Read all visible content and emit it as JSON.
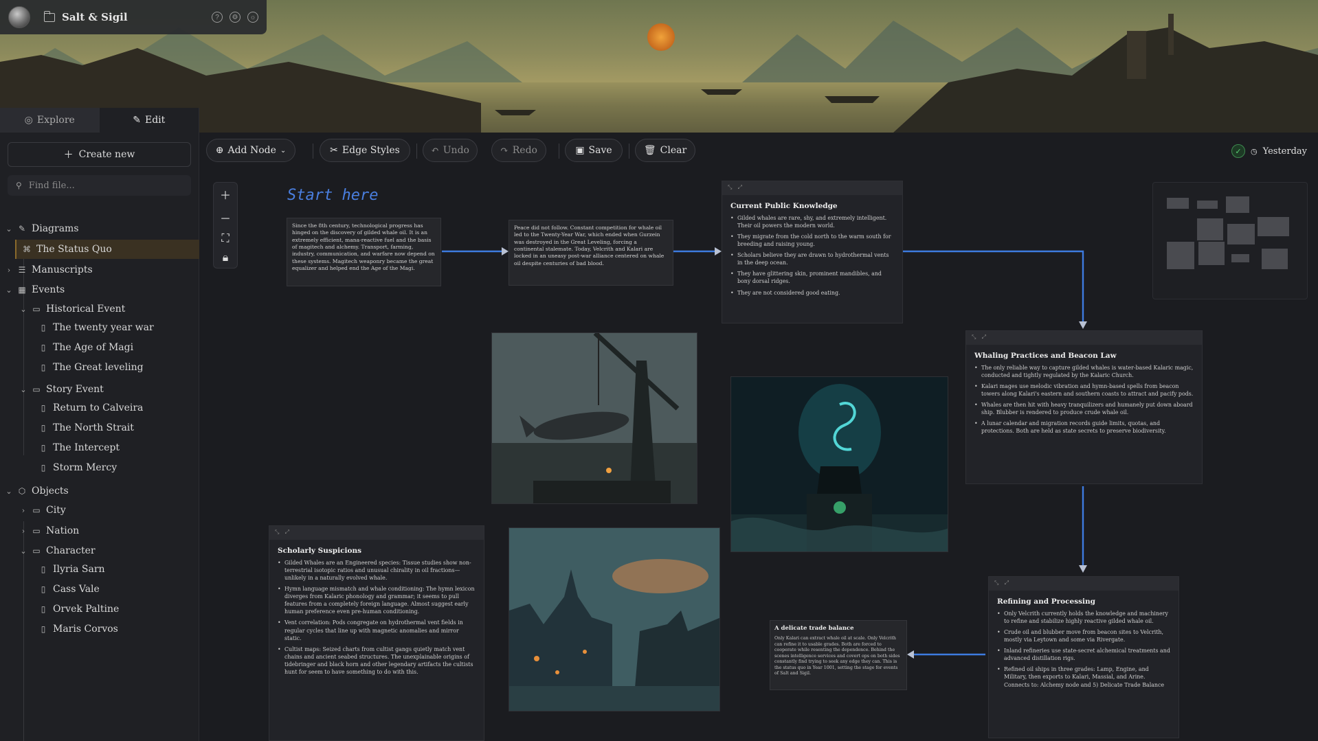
{
  "app": {
    "title": "Salt & Sigil"
  },
  "sidebar": {
    "tabs": [
      {
        "label": "Explore"
      },
      {
        "label": "Edit"
      }
    ],
    "create_label": "Create new",
    "search_placeholder": "Find file...",
    "tree": [
      {
        "label": "Diagrams",
        "kind": "section",
        "open": true
      },
      {
        "label": "The Status Quo",
        "kind": "diagram",
        "selected": true
      },
      {
        "label": "Manuscripts",
        "kind": "section",
        "open": false
      },
      {
        "label": "Events",
        "kind": "section",
        "open": true
      },
      {
        "label": "Historical Event",
        "kind": "folder",
        "open": true
      },
      {
        "label": "The twenty year war",
        "kind": "file"
      },
      {
        "label": "The Age of Magi",
        "kind": "file"
      },
      {
        "label": "The Great leveling",
        "kind": "file"
      },
      {
        "label": "Story Event",
        "kind": "folder",
        "open": true
      },
      {
        "label": "Return to Calveira",
        "kind": "file"
      },
      {
        "label": "The North Strait",
        "kind": "file"
      },
      {
        "label": "The Intercept",
        "kind": "file"
      },
      {
        "label": "Storm Mercy",
        "kind": "file"
      },
      {
        "label": "Objects",
        "kind": "section",
        "open": true
      },
      {
        "label": "City",
        "kind": "folder",
        "open": false
      },
      {
        "label": "Nation",
        "kind": "folder",
        "open": false
      },
      {
        "label": "Character",
        "kind": "folder",
        "open": true
      },
      {
        "label": "Ilyria Sarn",
        "kind": "file"
      },
      {
        "label": "Cass Vale",
        "kind": "file"
      },
      {
        "label": "Orvek Paltine",
        "kind": "file"
      },
      {
        "label": "Maris Corvos",
        "kind": "file"
      }
    ]
  },
  "toolbar": {
    "add_node": "Add Node",
    "edge_styles": "Edge Styles",
    "undo": "Undo",
    "redo": "Redo",
    "save": "Save",
    "clear": "Clear",
    "saved_label": "Yesterday"
  },
  "canvas": {
    "start_label": "Start here",
    "node1": "Since the 8th century, technological progress has hinged on the discovery of gilded whale oil. It is an extremely efficient, mana-reactive fuel and the basis of magitech and alchemy. Transport, farming, industry, communication, and warfare now depend on these systems. Magitech weaponry became the great equalizer and helped end the Age of the Magi.",
    "node2": "Peace did not follow. Constant competition for whale oil led to the Twenty-Year War, which ended when Gurzein was destroyed in the Great Leveling, forcing a continental stalemate. Today, Velcrith and Kalari are locked in an uneasy post-war alliance centered on whale oil despite centuries of bad blood.",
    "public": {
      "title": "Current Public Knowledge",
      "items": [
        "Gilded whales are rare, shy, and extremely intelligent. Their oil powers the modern world.",
        "They migrate from the cold north to the warm south for breeding and raising young.",
        "Scholars believe they are drawn to hydrothermal vents in the deep ocean.",
        "They have glittering skin, prominent mandibles, and bony dorsal ridges.",
        "They are not considered good eating."
      ]
    },
    "whaling": {
      "title": "Whaling Practices and Beacon Law",
      "items": [
        "The only reliable way to capture gilded whales is water-based Kalaric magic, conducted and tightly regulated by the Kalaric Church.",
        "Kalari mages use melodic vibration and hymn-based spells from beacon towers along Kalari's eastern and southern coasts to attract and pacify pods.",
        "Whales are then hit with heavy tranquilizers and humanely put down aboard ship. Blubber is rendered to produce crude whale oil.",
        "A lunar calendar and migration records guide limits, quotas, and protections. Both are held as state secrets to preserve biodiversity."
      ]
    },
    "scholarly": {
      "title": "Scholarly Suspicions",
      "items": [
        "Gilded Whales are an Engineered species: Tissue studies show non-terrestrial isotopic ratios and unusual chirality in oil fractions—unlikely in a naturally evolved whale.",
        "Hymn language mismatch and whale conditioning: The hymn lexicon diverges from Kalaric phonology and grammar; it seems to pull features from a completely foreign language. Almost suggest early human preference even pre-human conditioning.",
        "Vent correlation: Pods congregate on hydrothermal vent fields in regular cycles that line up with magnetic anomalies and mirror static.",
        "Cultist maps: Seized charts from cultist gangs quietly match vent chains and ancient seabed structures. The unexplainable origins of tidebringer and black horn and other legendary artifacts the cultists hunt for seem to have something to do with this."
      ]
    },
    "refining": {
      "title": "Refining and Processing",
      "items": [
        "Only Velcrith currently holds the knowledge and machinery to refine and stabilize highly reactive gilded whale oil.",
        "Crude oil and blubber move from beacon sites to Velcrith, mostly via Leytown and some via Rivergate.",
        "Inland refineries use state-secret alchemical treatments and advanced distillation rigs.",
        "Refined oil ships in three grades: Lamp, Engine, and Military, then exports to Kalari, Massial, and Arine. Connects to: Alchemy node and 5) Delicate Trade Balance"
      ]
    },
    "trade": {
      "title": "A delicate trade balance",
      "body": "Only Kalari can extract whale oil at scale. Only Velcrith can refine it to usable grades. Both are forced to cooperate while resenting the dependence. Behind the scenes intelligence services and covert ops on both sides constantly find trying to seek any edge they can. This is the status quo in Year 1001, setting the stage for events of Salt and Sigil."
    }
  }
}
